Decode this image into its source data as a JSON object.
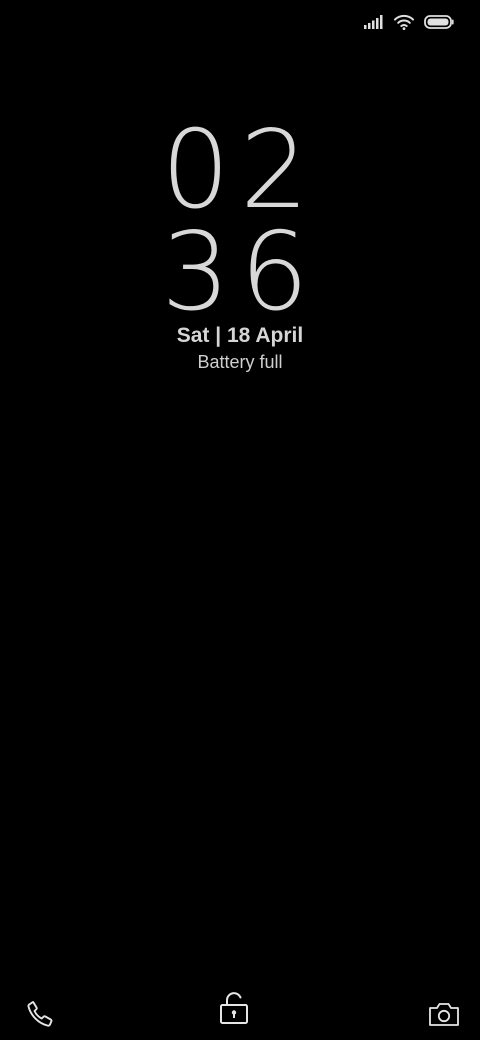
{
  "status_bar": {
    "signal_icon": "cellular-signal-icon",
    "wifi_icon": "wifi-icon",
    "battery_icon": "battery-icon",
    "battery_level": 1.0
  },
  "lock_screen": {
    "clock_hours": "02",
    "clock_minutes": "36",
    "date": "Sat | 18 April",
    "battery_status": "Battery full"
  },
  "shortcuts": {
    "phone_icon": "phone-icon",
    "unlock_icon": "unlock-icon",
    "camera_icon": "camera-icon"
  },
  "colors": {
    "background": "#000000",
    "foreground": "#d6d6d6"
  }
}
